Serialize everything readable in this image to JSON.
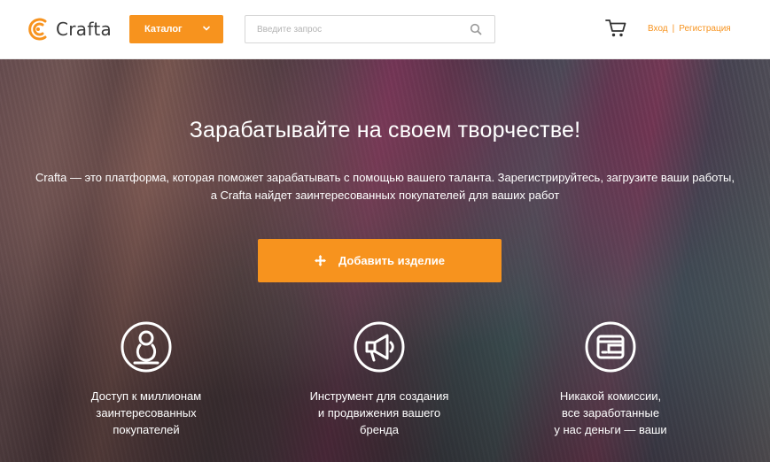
{
  "header": {
    "logo_text": "Crafta",
    "catalog_label": "Каталог",
    "search_placeholder": "Введите запрос",
    "login_label": "Вход",
    "separator": "|",
    "register_label": "Регистрация"
  },
  "hero": {
    "title": "Зарабатывайте на своем творчестве!",
    "description": "Crafta — это платформа, которая поможет зарабатывать с помощью вашего таланта. Зарегистрируйтесь, загрузите ваши работы, а Crafta найдет заинтересованных покупателей для ваших работ",
    "add_button_label": "Добавить изделие"
  },
  "features": [
    {
      "icon": "person-circle-icon",
      "text": "Доступ к миллионам\nзаинтересованных\nпокупателей"
    },
    {
      "icon": "megaphone-circle-icon",
      "text": "Инструмент для создания\nи продвижения вашего\nбренда"
    },
    {
      "icon": "wallet-circle-icon",
      "text": "Никакой комиссии,\nвсе заработанные\nу нас деньги — ваши"
    }
  ],
  "colors": {
    "accent": "#f7931e",
    "header_bg": "#ffffff",
    "hero_text": "#ffffff"
  }
}
